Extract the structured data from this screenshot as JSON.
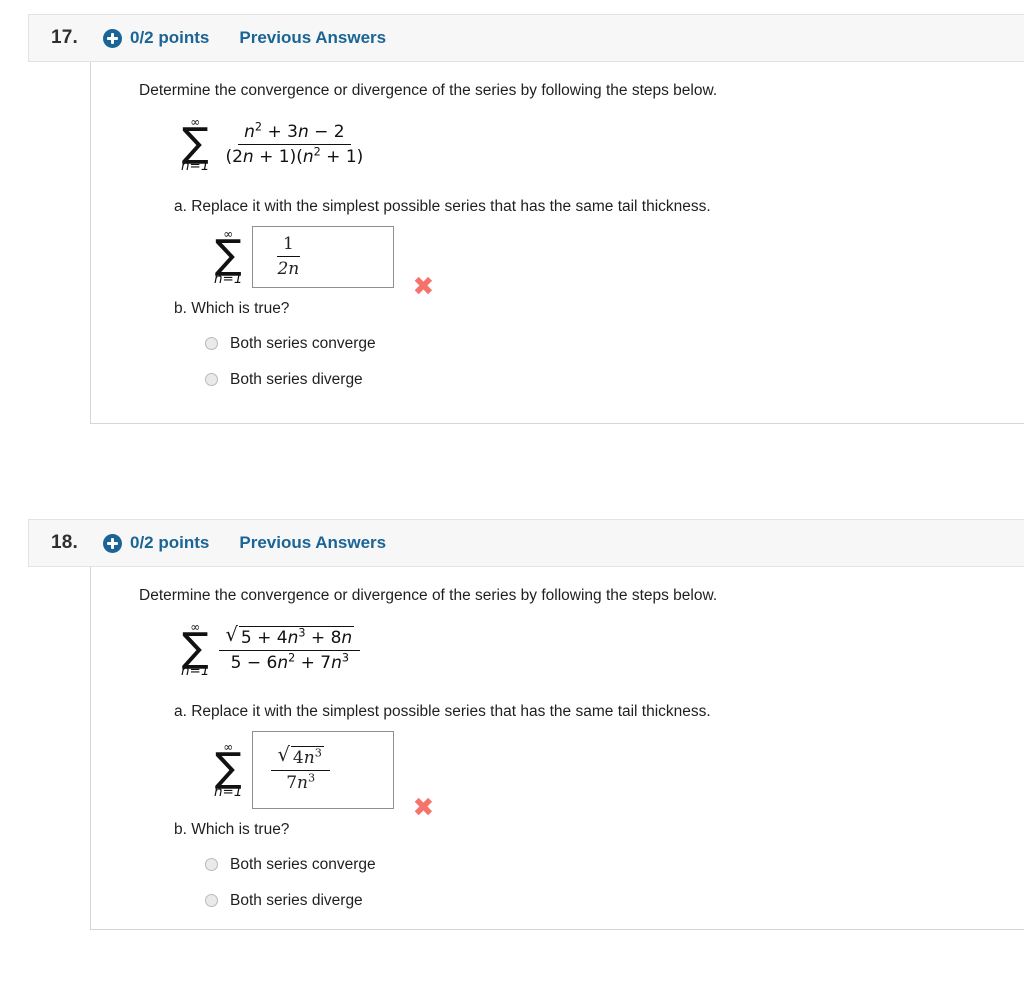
{
  "colors": {
    "accent_blue": "#1a6496",
    "wrong_red": "#f5736a",
    "header_bg": "#f7f7f7",
    "border_gray": "#d6d6d6",
    "box_border": "#8f8f8f"
  },
  "questions": [
    {
      "number": "17.",
      "points": "0/2 points",
      "previous_answers": "Previous Answers",
      "plus_icon": "plus-circle-icon",
      "prompt": "Determine the convergence or divergence of the series by following the steps below.",
      "series": {
        "sigma": "∑",
        "upper": "∞",
        "lower": "n=1",
        "numerator": "n² + 3n − 2",
        "denominator": "(2n + 1)(n² + 1)"
      },
      "part_a_label": "a. Replace it with the simplest possible series that has the same tail thickness.",
      "answer": {
        "sigma": "∑",
        "upper": "∞",
        "lower": "n=1",
        "numerator": "1",
        "denominator": "2n",
        "mark": "✖",
        "mark_meaning": "incorrect"
      },
      "part_b_label": "b. Which is true?",
      "choices": [
        {
          "label": "Both series converge",
          "selected": false
        },
        {
          "label": "Both series diverge",
          "selected": false
        }
      ]
    },
    {
      "number": "18.",
      "points": "0/2 points",
      "previous_answers": "Previous Answers",
      "plus_icon": "plus-circle-icon",
      "prompt": "Determine the convergence or divergence of the series by following the steps below.",
      "series": {
        "sigma": "∑",
        "upper": "∞",
        "lower": "n=1",
        "numerator": "√(5 + 4n³ + 8n)",
        "denominator": "5 − 6n² + 7n³"
      },
      "part_a_label": "a. Replace it with the simplest possible series that has the same tail thickness.",
      "answer": {
        "sigma": "∑",
        "upper": "∞",
        "lower": "n=1",
        "numerator": "√(4n³)",
        "denominator": "7n³",
        "mark": "✖",
        "mark_meaning": "incorrect"
      },
      "part_b_label": "b. Which is true?",
      "choices": [
        {
          "label": "Both series converge",
          "selected": false
        },
        {
          "label": "Both series diverge",
          "selected": false
        }
      ]
    }
  ]
}
